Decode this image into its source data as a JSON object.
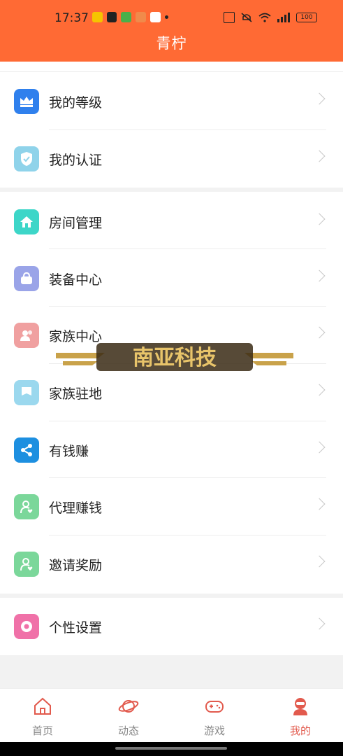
{
  "status_bar": {
    "time": "17:37",
    "battery": "100",
    "icons": [
      "notification-icon",
      "taobao-icon",
      "app-icon",
      "app-icon",
      "app-icon",
      "nfc-icon",
      "mute-icon",
      "wifi-icon",
      "signal-icon",
      "battery-icon"
    ]
  },
  "header": {
    "title": "青柠"
  },
  "menu": {
    "section1": [
      {
        "label": "我的等级",
        "icon": "crown-icon",
        "color": "#2f80ed"
      },
      {
        "label": "我的认证",
        "icon": "shield-check-icon",
        "color": "#8fd3ea"
      }
    ],
    "section2": [
      {
        "label": "房间管理",
        "icon": "home-icon",
        "color": "#3dd6c8"
      },
      {
        "label": "装备中心",
        "icon": "bag-icon",
        "color": "#9aa4e8"
      },
      {
        "label": "家族中心",
        "icon": "family-icon",
        "color": "#f0a0a0"
      },
      {
        "label": "家族驻地",
        "icon": "flag-icon",
        "color": "#9bd8ee"
      },
      {
        "label": "有钱赚",
        "icon": "share-icon",
        "color": "#1d8fe0"
      },
      {
        "label": "代理赚钱",
        "icon": "user-heart-icon",
        "color": "#7bd79a"
      },
      {
        "label": "邀请奖励",
        "icon": "user-heart-icon",
        "color": "#7bd79a"
      }
    ],
    "section3": [
      {
        "label": "个性设置",
        "icon": "flower-gear-icon",
        "color": "#f071a8"
      }
    ]
  },
  "watermark": {
    "text": "南亚科技"
  },
  "tabbar": {
    "tabs": [
      {
        "label": "首页",
        "icon": "home-tab-icon"
      },
      {
        "label": "动态",
        "icon": "planet-icon"
      },
      {
        "label": "游戏",
        "icon": "gamepad-icon"
      },
      {
        "label": "我的",
        "icon": "profile-icon",
        "active": true
      }
    ]
  },
  "colors": {
    "accent": "#ff6a34",
    "tab_active": "#e25a4d"
  }
}
